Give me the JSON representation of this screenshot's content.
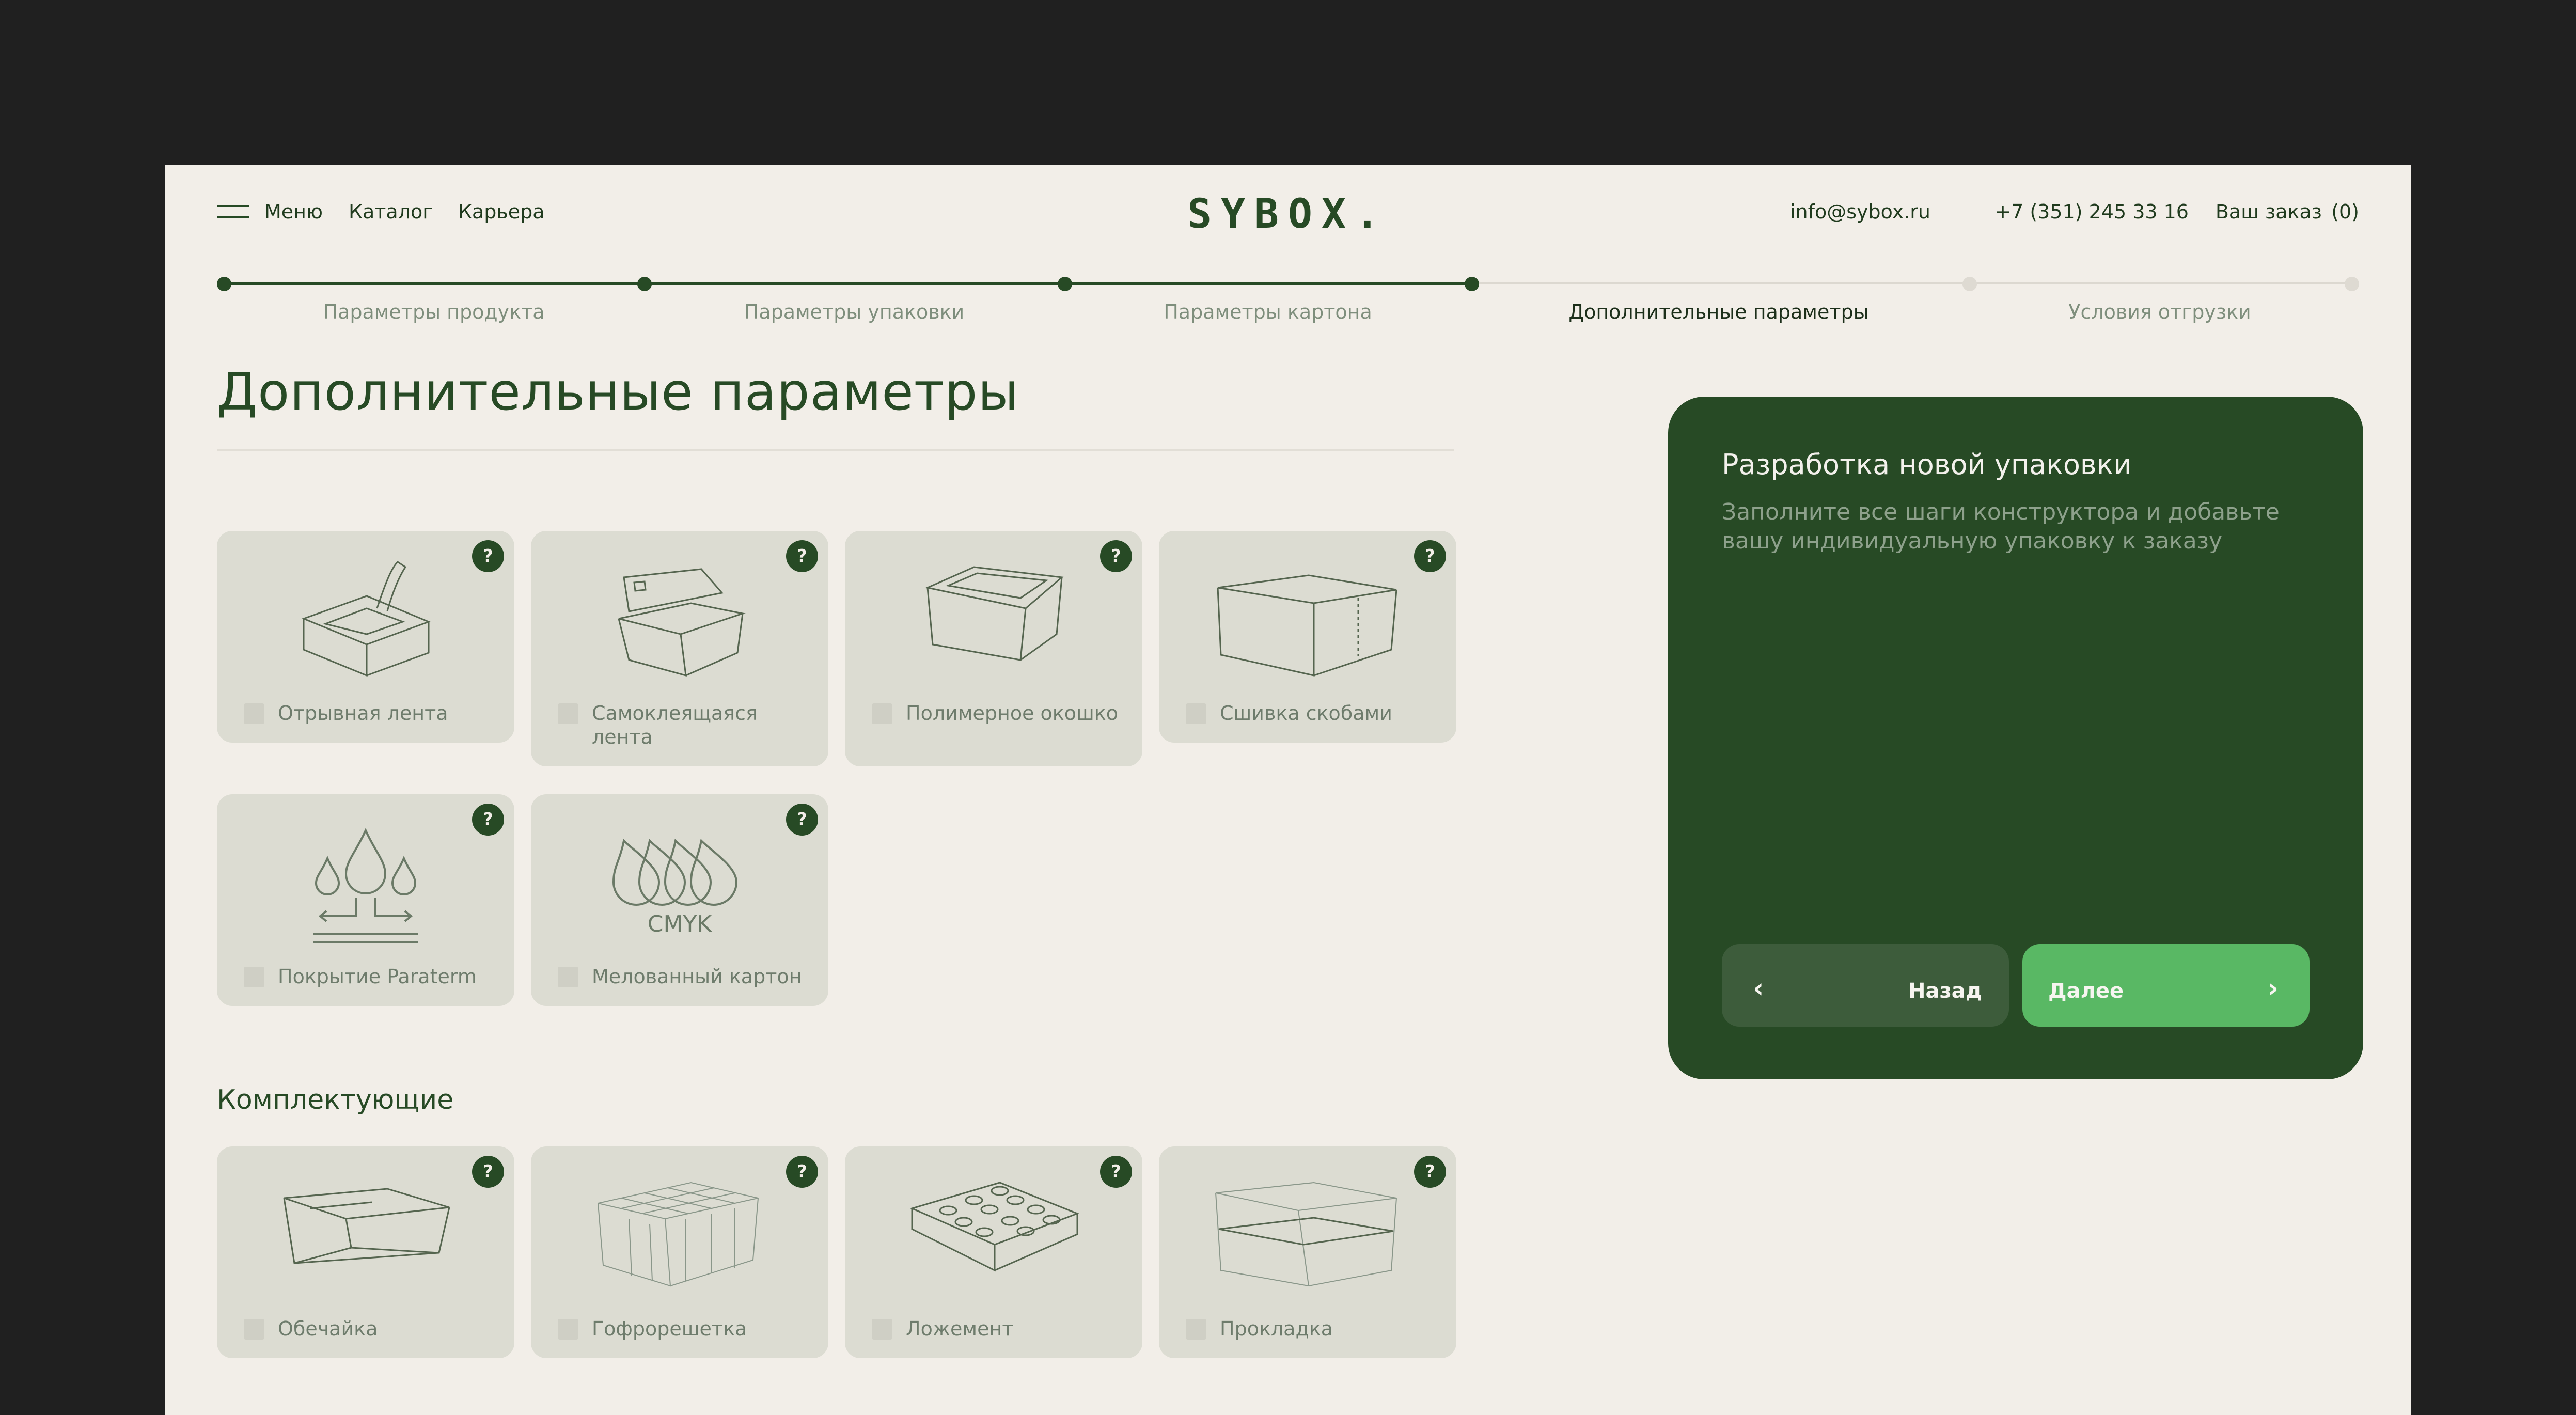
{
  "header": {
    "menu_label": "Меню",
    "nav": [
      "Каталог",
      "Карьера"
    ],
    "logo": "SYBOX.",
    "email": "info@sybox.ru",
    "phone": "+7 (351) 245 33 16",
    "order_label": "Ваш заказ",
    "order_count": "(0)"
  },
  "steps": [
    {
      "label": "Параметры продукта",
      "status": "done"
    },
    {
      "label": "Параметры упаковки",
      "status": "done"
    },
    {
      "label": "Параметры картона",
      "status": "done"
    },
    {
      "label": "Дополнительные параметры",
      "status": "active"
    },
    {
      "label": "Условия отгрузки",
      "status": "todo"
    }
  ],
  "page_title": "Дополнительные параметры",
  "options": [
    {
      "label": "Отрывная лента",
      "icon": "tear-tape-box-icon"
    },
    {
      "label": "Самоклеящаяся лента",
      "icon": "self-adhesive-box-icon"
    },
    {
      "label": "Полимерное окошко",
      "icon": "window-box-icon"
    },
    {
      "label": "Сшивка скобами",
      "icon": "staple-box-icon"
    },
    {
      "label": "Покрытие Paraterm",
      "icon": "water-drops-icon"
    },
    {
      "label": "Мелованный картон",
      "icon": "cmyk-drops-icon",
      "icon_text": "CMYK"
    }
  ],
  "components_title": "Комплектующие",
  "components": [
    {
      "label": "Обечайка",
      "icon": "sleeve-icon"
    },
    {
      "label": "Гофрорешетка",
      "icon": "grid-insert-icon"
    },
    {
      "label": "Ложемент",
      "icon": "lodgement-icon"
    },
    {
      "label": "Прокладка",
      "icon": "pad-icon"
    }
  ],
  "help_glyph": "?",
  "panel": {
    "title": "Разработка новой упаковки",
    "subtitle": "Заполните все шаги конструктора и добавьте вашу индивидуальную упаковку к заказу",
    "back_label": "Назад",
    "next_label": "Далее",
    "back_arrow": "‹",
    "next_arrow": "›"
  },
  "colors": {
    "brand_green": "#274a25",
    "accent_green": "#59b864",
    "page_bg": "#f2eee8",
    "card_bg": "#dcdcd2"
  }
}
